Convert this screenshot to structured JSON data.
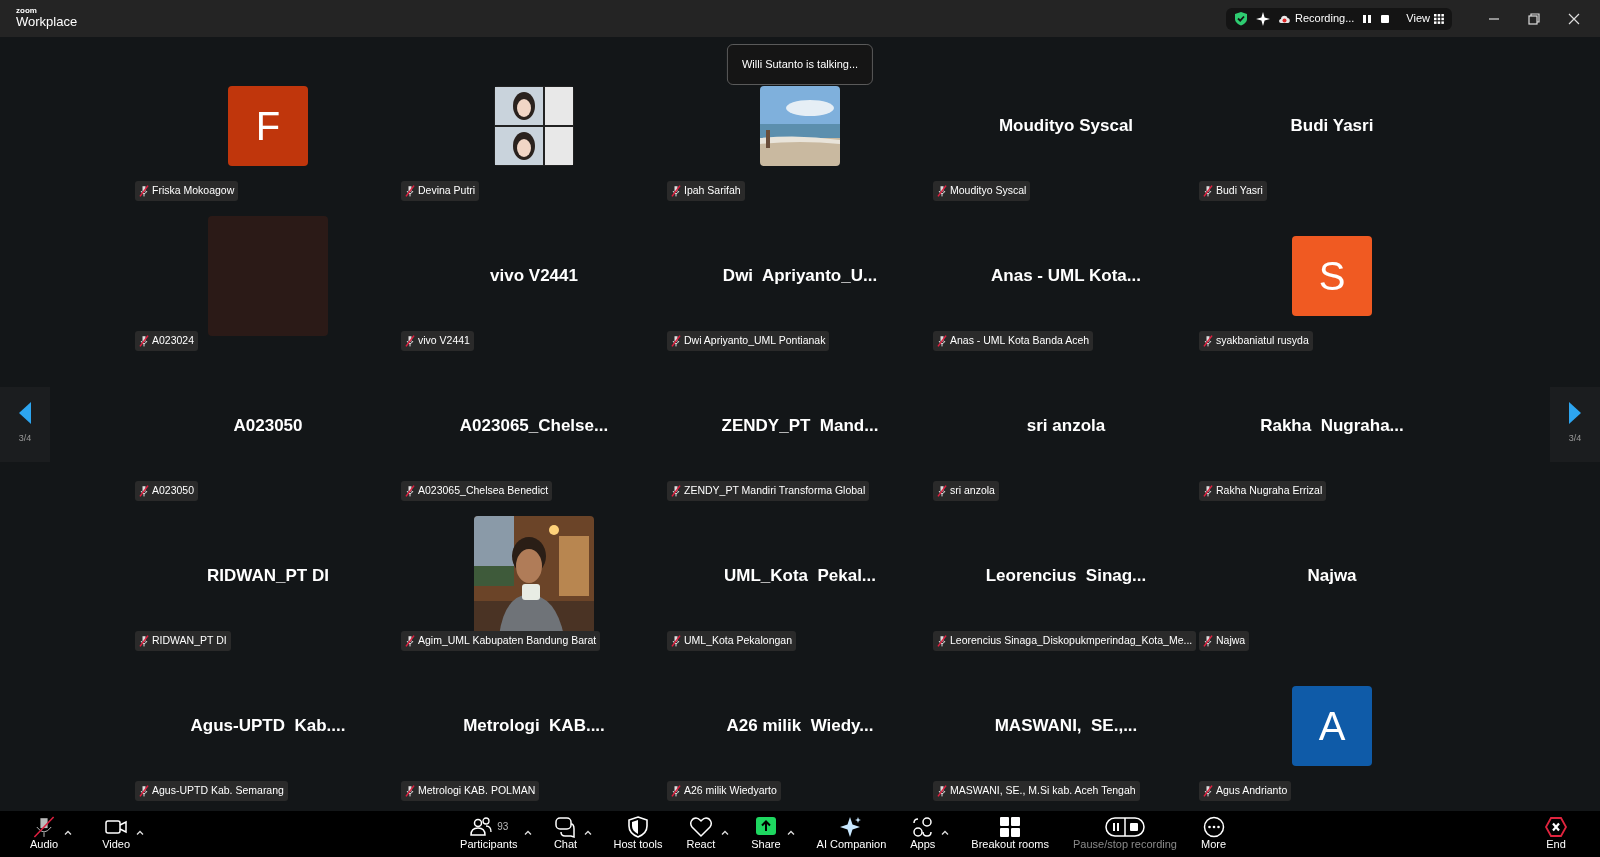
{
  "window": {
    "logo_top": "zoom",
    "logo_bottom": "Workplace"
  },
  "status_pill": {
    "recording_label": "Recording...",
    "view_label": "View"
  },
  "toast": "Willi Sutanto is talking...",
  "pager": {
    "left": "3/4",
    "right": "3/4"
  },
  "tiles": [
    {
      "kind": "initial",
      "initial": "F",
      "color": "#c0360c",
      "label": "Friska Mokoagow",
      "muted": true
    },
    {
      "kind": "picture",
      "label": "Devina Putri",
      "muted": true
    },
    {
      "kind": "picture",
      "label": "Ipah Sarifah",
      "muted": true
    },
    {
      "kind": "name",
      "display_name": "Moudityo Syscal",
      "label": "Moudityo Syscal",
      "muted": true
    },
    {
      "kind": "name",
      "display_name": "Budi Yasri",
      "label": "Budi Yasri",
      "muted": true
    },
    {
      "kind": "dark-video",
      "label": "A023024",
      "muted": true
    },
    {
      "kind": "name",
      "display_name": "vivo V2441",
      "label": "vivo V2441",
      "muted": true
    },
    {
      "kind": "name",
      "display_name": "Dwi  Apriyanto_U...",
      "label": "Dwi Apriyanto_UML Pontianak",
      "muted": true
    },
    {
      "kind": "name",
      "display_name": "Anas - UML Kota...",
      "label": "Anas - UML Kota Banda Aceh",
      "muted": true
    },
    {
      "kind": "initial",
      "initial": "S",
      "color": "#f05a22",
      "label": "syakbaniatul rusyda",
      "muted": true
    },
    {
      "kind": "name",
      "display_name": "A023050",
      "label": "A023050",
      "muted": true
    },
    {
      "kind": "name",
      "display_name": "A023065_Chelse...",
      "label": "A023065_Chelsea Benedict",
      "muted": true
    },
    {
      "kind": "name",
      "display_name": "ZENDY_PT  Mand...",
      "label": "ZENDY_PT Mandiri Transforma Global",
      "muted": true
    },
    {
      "kind": "name",
      "display_name": "sri anzola",
      "label": "sri anzola",
      "muted": true
    },
    {
      "kind": "name",
      "display_name": "Rakha  Nugraha...",
      "label": "Rakha Nugraha Errizal",
      "muted": true
    },
    {
      "kind": "name",
      "display_name": "RIDWAN_PT DI",
      "label": "RIDWAN_PT DI",
      "muted": true
    },
    {
      "kind": "picture",
      "label": "Agim_UML Kabupaten Bandung Barat",
      "muted": true
    },
    {
      "kind": "name",
      "display_name": "UML_Kota  Pekal...",
      "label": "UML_Kota Pekalongan",
      "muted": true
    },
    {
      "kind": "name",
      "display_name": "Leorencius  Sinag...",
      "label": "Leorencius Sinaga_Diskopukmperindag_Kota_Me...",
      "muted": true
    },
    {
      "kind": "name",
      "display_name": "Najwa",
      "label": "Najwa",
      "muted": true
    },
    {
      "kind": "name",
      "display_name": "Agus-UPTD  Kab....",
      "label": "Agus-UPTD Kab. Semarang",
      "muted": true
    },
    {
      "kind": "name",
      "display_name": "Metrologi  KAB....",
      "label": "Metrologi KAB. POLMAN",
      "muted": true
    },
    {
      "kind": "name",
      "display_name": "A26 milik  Wiedy...",
      "label": "A26 milik Wiedyarto",
      "muted": true
    },
    {
      "kind": "name",
      "display_name": "MASWANI,  SE.,...",
      "label": "MASWANI, SE., M.Si kab. Aceh Tengah",
      "muted": true
    },
    {
      "kind": "initial",
      "initial": "A",
      "color": "#0f5ba8",
      "label": "Agus Andrianto",
      "muted": true
    }
  ],
  "toolbar": [
    {
      "label": "Audio",
      "caret": true,
      "muted": true,
      "disabled": false
    },
    {
      "label": "Video",
      "caret": true,
      "disabled": false
    },
    {
      "label": "Participants",
      "count": "93",
      "caret": true,
      "disabled": false
    },
    {
      "label": "Chat",
      "caret": true,
      "disabled": false
    },
    {
      "label": "Host tools",
      "caret": false,
      "disabled": false
    },
    {
      "label": "React",
      "caret": true,
      "disabled": false
    },
    {
      "label": "Share",
      "caret": true,
      "disabled": false
    },
    {
      "label": "AI Companion",
      "caret": false,
      "disabled": false
    },
    {
      "label": "Apps",
      "caret": true,
      "disabled": false
    },
    {
      "label": "Breakout rooms",
      "caret": false,
      "disabled": false
    },
    {
      "label": "Pause/stop recording",
      "caret": false,
      "disabled": true
    },
    {
      "label": "More",
      "caret": false,
      "disabled": false
    },
    {
      "label": "End",
      "caret": false,
      "disabled": false
    }
  ]
}
